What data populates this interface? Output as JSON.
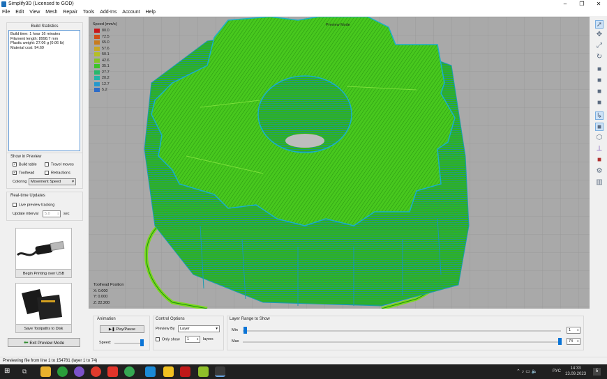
{
  "window": {
    "title": "Simplify3D (Licensed to GOD)",
    "controls": [
      "–",
      "❐",
      "✕"
    ]
  },
  "menu": [
    "File",
    "Edit",
    "View",
    "Mesh",
    "Repair",
    "Tools",
    "Add-Ins",
    "Account",
    "Help"
  ],
  "build_stats": {
    "title": "Build Statistics",
    "lines": [
      "Build time: 1 hour 16 minutes",
      "Filament length: 8998.7 mm",
      "Plastic weight: 27.06 g (0.06 lb)",
      "Material cost: 94.69"
    ]
  },
  "show_in_preview": {
    "title": "Show in Preview",
    "build_table": "Build table",
    "build_table_checked": true,
    "travel_moves": "Travel moves",
    "travel_checked": false,
    "toolhead": "Toolhead",
    "toolhead_checked": true,
    "retractions": "Retractions",
    "retractions_checked": false,
    "coloring_label": "Coloring",
    "coloring_value": "Movement Speed"
  },
  "realtime": {
    "title": "Real-time Updates",
    "live_tracking": "Live preview tracking",
    "interval_label": "Update interval",
    "interval_value": "5,0",
    "interval_unit": "sec"
  },
  "usb_card": {
    "label": "Begin Printing over USB"
  },
  "sd_card": {
    "label": "Save Toolpaths to Disk"
  },
  "exit_preview": "Exit Preview Mode",
  "viewport": {
    "mode_label": "Preview Mode",
    "legend_title": "Speed (mm/s)",
    "legend": [
      {
        "value": "80.0",
        "color": "#c8181c"
      },
      {
        "value": "72.5",
        "color": "#d0501a"
      },
      {
        "value": "65.0",
        "color": "#c87c1e"
      },
      {
        "value": "57.6",
        "color": "#c8a824"
      },
      {
        "value": "50.1",
        "color": "#b4c024"
      },
      {
        "value": "42.6",
        "color": "#84c424"
      },
      {
        "value": "35.1",
        "color": "#3cc428"
      },
      {
        "value": "27.7",
        "color": "#28b86c"
      },
      {
        "value": "20.2",
        "color": "#24b4a8"
      },
      {
        "value": "12.7",
        "color": "#2498cc"
      },
      {
        "value": "5.2",
        "color": "#2c6cc8"
      }
    ],
    "toolhead_title": "Toolhead Position",
    "toolhead_x": "X: 0.000",
    "toolhead_y": "Y: 0.000",
    "toolhead_z": "Z: 22.200"
  },
  "animation": {
    "title": "Animation",
    "play_label": "Play/Pause",
    "speed_label": "Speed:"
  },
  "control_options": {
    "title": "Control Options",
    "preview_by_label": "Preview By",
    "preview_by_value": "Layer",
    "only_show_label": "Only show",
    "only_show_value": "1",
    "layers_label": "layers"
  },
  "layer_range": {
    "title": "Layer Range to Show",
    "min_label": "Min",
    "min_value": "1",
    "max_label": "Max",
    "max_value": "74"
  },
  "status": "Previewing file from line 1 to 154781 (layer 1 to 74)",
  "taskbar": {
    "lang": "РУС",
    "time": "14:33",
    "date": "13.09.2023",
    "notif": "5"
  },
  "colors": {
    "accent": "#0a74d6",
    "gear_green": "#3ec41c",
    "viewport_bg": "#a9a9a9"
  }
}
